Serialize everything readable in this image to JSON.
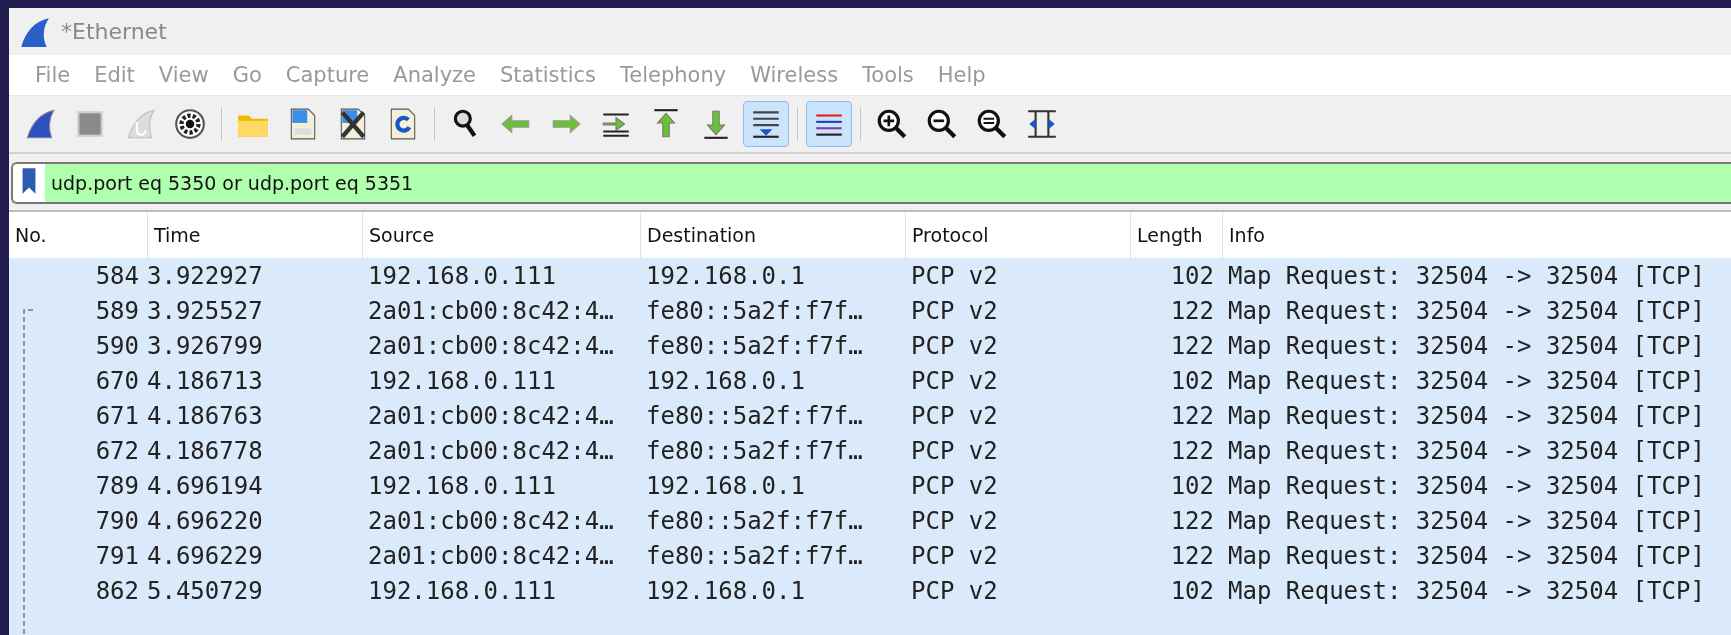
{
  "window": {
    "title": "*Ethernet"
  },
  "menu": [
    {
      "label": "File",
      "disabled": true
    },
    {
      "label": "Edit",
      "disabled": true
    },
    {
      "label": "View",
      "disabled": true
    },
    {
      "label": "Go",
      "disabled": true
    },
    {
      "label": "Capture",
      "disabled": true
    },
    {
      "label": "Analyze",
      "disabled": true
    },
    {
      "label": "Statistics",
      "disabled": true
    },
    {
      "label": "Telephony",
      "disabled": true
    },
    {
      "label": "Wireless",
      "disabled": true
    },
    {
      "label": "Tools",
      "disabled": true
    },
    {
      "label": "Help",
      "disabled": true
    }
  ],
  "toolbar": [
    {
      "kind": "start",
      "on": false
    },
    {
      "kind": "stop",
      "on": false
    },
    {
      "kind": "restart",
      "on": false
    },
    {
      "kind": "options",
      "on": false
    },
    {
      "kind": "sep"
    },
    {
      "kind": "open",
      "on": false
    },
    {
      "kind": "save",
      "on": false
    },
    {
      "kind": "close",
      "on": false
    },
    {
      "kind": "reload",
      "on": false
    },
    {
      "kind": "sep"
    },
    {
      "kind": "find",
      "on": false
    },
    {
      "kind": "back",
      "on": false
    },
    {
      "kind": "forward",
      "on": false
    },
    {
      "kind": "goto",
      "on": false
    },
    {
      "kind": "first",
      "on": false
    },
    {
      "kind": "last",
      "on": false
    },
    {
      "kind": "autoscroll",
      "on": true
    },
    {
      "kind": "sep"
    },
    {
      "kind": "colorize",
      "on": true
    },
    {
      "kind": "sep"
    },
    {
      "kind": "zoom-in",
      "on": false
    },
    {
      "kind": "zoom-out",
      "on": false
    },
    {
      "kind": "zoom-normal",
      "on": false
    },
    {
      "kind": "resize",
      "on": false
    }
  ],
  "filter": {
    "value": "udp.port eq 5350 or udp.port eq 5351"
  },
  "table": {
    "columns": [
      "No.",
      "Time",
      "Source",
      "Destination",
      "Protocol",
      "Length",
      "Info"
    ],
    "rows": [
      [
        "584",
        "3.922927",
        "192.168.0.111",
        "192.168.0.1",
        "PCP v2",
        "102",
        "Map Request: 32504 -> 32504 [TCP]"
      ],
      [
        "589",
        "3.925527",
        "2a01:cb00:8c42:4…",
        "fe80::5a2f:f7f…",
        "PCP v2",
        "122",
        "Map Request: 32504 -> 32504 [TCP]"
      ],
      [
        "590",
        "3.926799",
        "2a01:cb00:8c42:4…",
        "fe80::5a2f:f7f…",
        "PCP v2",
        "122",
        "Map Request: 32504 -> 32504 [TCP]"
      ],
      [
        "670",
        "4.186713",
        "192.168.0.111",
        "192.168.0.1",
        "PCP v2",
        "102",
        "Map Request: 32504 -> 32504 [TCP]"
      ],
      [
        "671",
        "4.186763",
        "2a01:cb00:8c42:4…",
        "fe80::5a2f:f7f…",
        "PCP v2",
        "122",
        "Map Request: 32504 -> 32504 [TCP]"
      ],
      [
        "672",
        "4.186778",
        "2a01:cb00:8c42:4…",
        "fe80::5a2f:f7f…",
        "PCP v2",
        "122",
        "Map Request: 32504 -> 32504 [TCP]"
      ],
      [
        "789",
        "4.696194",
        "192.168.0.111",
        "192.168.0.1",
        "PCP v2",
        "102",
        "Map Request: 32504 -> 32504 [TCP]"
      ],
      [
        "790",
        "4.696220",
        "2a01:cb00:8c42:4…",
        "fe80::5a2f:f7f…",
        "PCP v2",
        "122",
        "Map Request: 32504 -> 32504 [TCP]"
      ],
      [
        "791",
        "4.696229",
        "2a01:cb00:8c42:4…",
        "fe80::5a2f:f7f…",
        "PCP v2",
        "122",
        "Map Request: 32504 -> 32504 [TCP]"
      ],
      [
        "862",
        "5.450729",
        "192.168.0.111",
        "192.168.0.1",
        "PCP v2",
        "102",
        "Map Request: 32504 -> 32504 [TCP]"
      ]
    ]
  }
}
